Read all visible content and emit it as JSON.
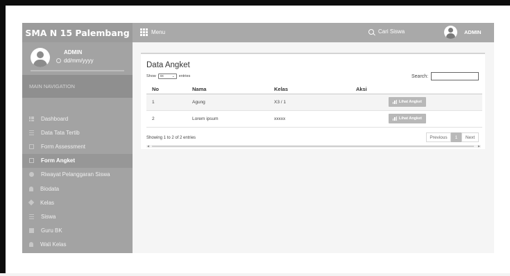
{
  "app": {
    "brand": "SMA N 15 Palembang",
    "colors": {
      "topbar": "#a9a9a9",
      "sidebar": "#a3a3a3",
      "brand_bg": "#9b9b9b",
      "active_item": "#979797"
    }
  },
  "topbar": {
    "menu_label": "Menu",
    "search_label": "Cari Siswa",
    "user_label": "ADMIN"
  },
  "sidebar": {
    "user_name": "ADMIN",
    "user_date": "dd/mm/yyyy",
    "nav_header": "MAIN NAVIGATION",
    "items": [
      {
        "label": "Dashboard",
        "icon": "grid-icon"
      },
      {
        "label": "Data Tata Tertib",
        "icon": "list-icon"
      },
      {
        "label": "Form Assessment",
        "icon": "form-icon"
      },
      {
        "label": "Form Angket",
        "icon": "form-icon",
        "active": true
      },
      {
        "label": "Riwayat Pelanggaran Siswa",
        "icon": "history-icon"
      },
      {
        "label": "Biodata",
        "icon": "user-icon"
      },
      {
        "label": "Kelas",
        "icon": "tag-icon"
      },
      {
        "label": "Siswa",
        "icon": "graduation-icon"
      },
      {
        "label": "Guru BK",
        "icon": "book-icon"
      },
      {
        "label": "Wali Kelas",
        "icon": "user-icon"
      }
    ]
  },
  "main": {
    "title": "Data Angket",
    "length": {
      "show": "Show",
      "value": "xx",
      "entries": "entries"
    },
    "search_label": "Search:",
    "table": {
      "headers": [
        "No",
        "Nama",
        "Kelas",
        "Aksi"
      ],
      "rows": [
        {
          "no": "1",
          "nama": "Agung",
          "kelas": "X3 / 1",
          "action": "Lihat Angket"
        },
        {
          "no": "2",
          "nama": "Lorem ipsum",
          "kelas": "xxxxx",
          "action": "Lihat Angket"
        }
      ]
    },
    "info": "Showing 1 to 2 of 2 entries",
    "pagination": {
      "previous": "Previous",
      "page": "1",
      "next": "Next"
    }
  }
}
